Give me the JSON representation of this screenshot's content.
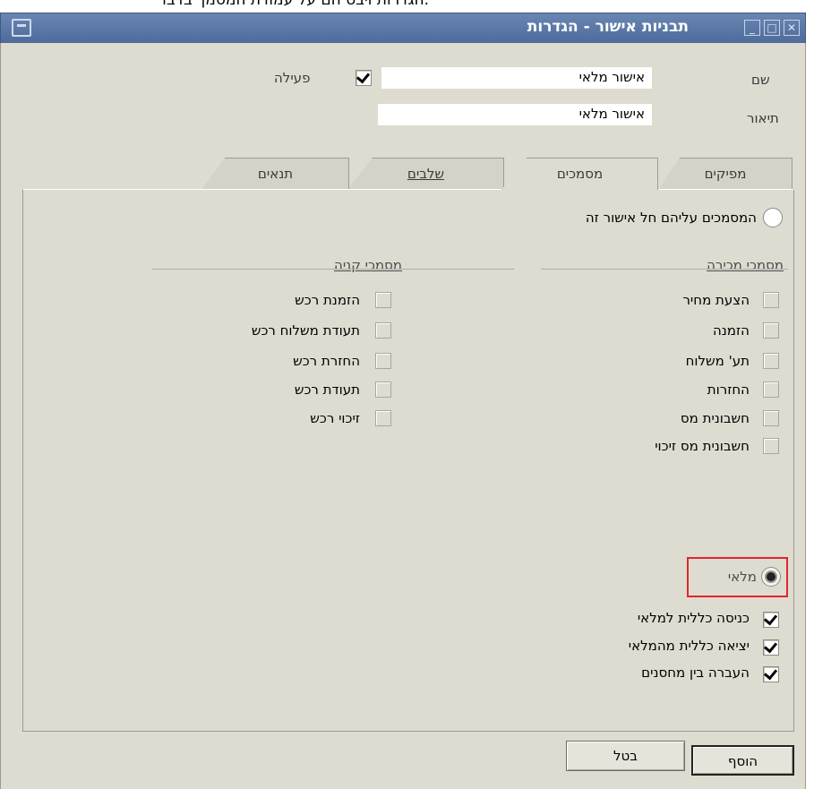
{
  "caption_text": "הגדרות ויבט הם על עמודת המסמך בדבר.",
  "window": {
    "title": "תבניות אישור - הגדרות",
    "icons": [
      "minimize-icon",
      "maximize-icon",
      "close-icon"
    ]
  },
  "header": {
    "name_label": "שם",
    "name_value": "אישור מלאי",
    "active_label": "פעילה",
    "active_checked": true,
    "description_label": "תיאור",
    "description_value": "אישור מלאי"
  },
  "tabs": [
    {
      "label": "מפיקים",
      "active": false
    },
    {
      "label": "מסמכים",
      "active": true
    },
    {
      "label": "שלבים",
      "active": false
    },
    {
      "label": "תנאים",
      "active": false
    }
  ],
  "documents": {
    "applies_label": "המסמכים עליהם חל אישור זה",
    "sales_heading": "מסמכי מכירה",
    "purchase_heading": "מסמכי קניה",
    "sales_items": [
      {
        "label": "הצעת מחיר",
        "checked": false
      },
      {
        "label": "הזמנה",
        "checked": false
      },
      {
        "label": "תע' משלוח",
        "checked": false
      },
      {
        "label": "החזרות",
        "checked": false
      },
      {
        "label": "חשבונית מס",
        "checked": false
      },
      {
        "label": "חשבונית מס זיכוי",
        "checked": false
      }
    ],
    "purchase_items": [
      {
        "label": "הזמנת רכש",
        "checked": false
      },
      {
        "label": "תעודת משלוח רכש",
        "checked": false
      },
      {
        "label": "החזרת רכש",
        "checked": false
      },
      {
        "label": "תעודת רכש",
        "checked": false
      },
      {
        "label": "זיכוי רכש",
        "checked": false
      }
    ],
    "inventory_label": "מלאי",
    "inventory_selected": true,
    "inventory_items": [
      {
        "label": "כניסה כללית למלאי",
        "checked": true
      },
      {
        "label": "יציאה כללית מהמלאי",
        "checked": true
      },
      {
        "label": "העברה בין מחסנים",
        "checked": true
      }
    ]
  },
  "buttons": {
    "add_label": "הוסף",
    "cancel_label": "בטל"
  },
  "colors": {
    "title_bar": "#5a78a8",
    "window_bg": "#dedcd1",
    "highlight": "#e0262e"
  }
}
